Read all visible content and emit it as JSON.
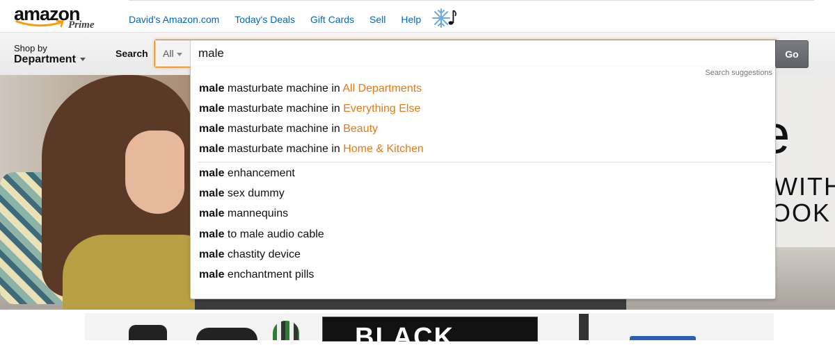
{
  "logo": {
    "word": "amazon",
    "prime": "Prime"
  },
  "nav": [
    "David's Amazon.com",
    "Today's Deals",
    "Gift Cards",
    "Sell",
    "Help"
  ],
  "shop_by": {
    "line1": "Shop by",
    "line2": "Department"
  },
  "search": {
    "label": "Search",
    "scope": "All",
    "query": "male",
    "go_label": "Go"
  },
  "suggestions": {
    "header": "Search suggestions",
    "prefix": "male",
    "dept_items": [
      {
        "text": " masturbate machine in ",
        "dept": "All Departments"
      },
      {
        "text": " masturbate machine in ",
        "dept": "Everything Else"
      },
      {
        "text": " masturbate machine in ",
        "dept": "Beauty"
      },
      {
        "text": " masturbate machine in ",
        "dept": "Home & Kitchen"
      }
    ],
    "items": [
      " enhancement",
      " sex dummy",
      " mannequins",
      " to male audio cable",
      " chastity device",
      " enchantment pills"
    ]
  },
  "hero": {
    "text1": "e",
    "text2": "WITH",
    "text3": "OOK"
  },
  "strip": {
    "product_text": "BLACK"
  },
  "colors": {
    "link": "#0066c0",
    "dept": "#e47911",
    "focus": "#e77600",
    "logo_smile": "#ff9900"
  }
}
